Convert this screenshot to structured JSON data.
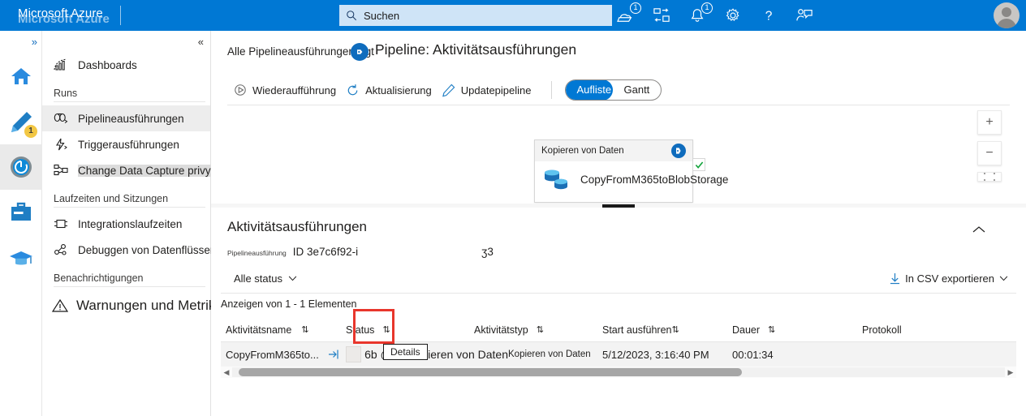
{
  "topbar": {
    "brand": "Microsoft Azure",
    "search_placeholder": "Suchen",
    "cloud_shell_badge": "1",
    "notifications_badge": "1",
    "accent": "#0078d4"
  },
  "rail": {
    "expand_label": "»",
    "items": [
      {
        "name": "home",
        "badge": ""
      },
      {
        "name": "author",
        "badge": "1"
      },
      {
        "name": "monitor",
        "badge": ""
      },
      {
        "name": "manage",
        "badge": ""
      },
      {
        "name": "learning-center",
        "badge": ""
      }
    ]
  },
  "sidenav": {
    "collapse_label": "«",
    "dashboards": "Dashboards",
    "sections": [
      {
        "title": "Runs",
        "items": [
          {
            "label": "Pipelineausführungen",
            "active": true,
            "highlight": false
          },
          {
            "label": "Triggerausführungen",
            "active": false,
            "highlight": false
          },
          {
            "label": "Change Data Capture privy",
            "active": false,
            "highlight": true
          }
        ]
      },
      {
        "title": "Laufzeiten und Sitzungen",
        "items": [
          {
            "label": "Integrationslaufzeiten",
            "active": false,
            "highlight": false
          },
          {
            "label": "Debuggen von Datenflüssen",
            "active": false,
            "highlight": false
          }
        ]
      },
      {
        "title": "Benachrichtigungen",
        "items": []
      }
    ],
    "alerts": "Warnungen und Metriken"
  },
  "breadcrumb": {
    "text": "Alle Pipelineausführungen &gt"
  },
  "page": {
    "title": "Pipeline: Aktivitätsausführungen"
  },
  "toolbar": {
    "rerun": "Wiederaufführung",
    "refresh": "Aktualisierung",
    "update_pipeline": "Updatepipeline",
    "view_toggle": {
      "options": [
        "Auflistе",
        "Gantt"
      ],
      "selected": "Auflistе"
    }
  },
  "canvas": {
    "card": {
      "header": "Kopieren von Daten",
      "name": "CopyFromM365toBlobStorage",
      "status": "succeeded"
    },
    "zoom_in": "+",
    "zoom_out": "−",
    "fit": "fit-to-screen"
  },
  "panel": {
    "title": "Aktivitätsausführungen",
    "run_label": "Pipelineausführung",
    "run_id": "ID 3e7c6f92-i",
    "run_id_tail": "ʒ3",
    "status_filter": "Alle status",
    "export_label": "In CSV exportieren",
    "showing": "Anzeigen von 1 - 1 Elementen",
    "columns": [
      "Aktivitätsname",
      "Status",
      "Aktivitätstyp",
      "Start ausführen",
      "Dauer",
      "Protokoll"
    ],
    "rows": [
      {
        "name": "CopyFromM365to...",
        "status": "6b @ Extrahieren von Daten",
        "type": "Kopieren von Daten",
        "start": "5/12/2023, 3:16:40 PM",
        "duration": "00:01:34",
        "log": ""
      }
    ],
    "tooltip": "Details",
    "highlight_color": "#e8362c"
  }
}
